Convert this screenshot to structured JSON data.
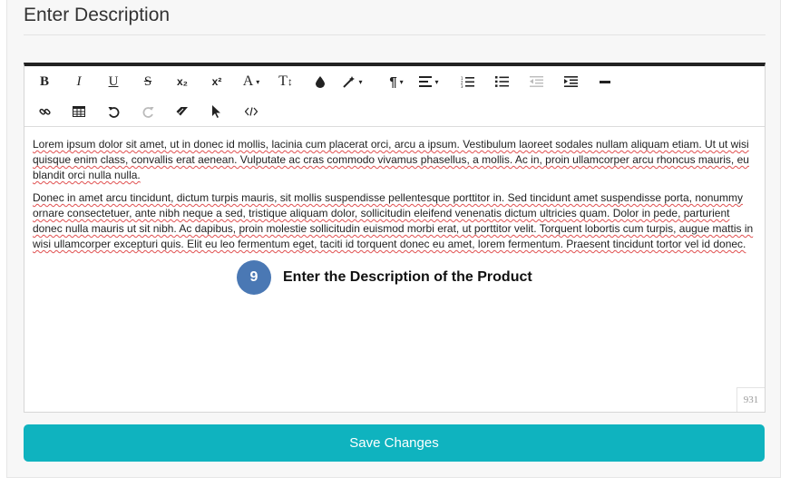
{
  "header": {
    "title": "Enter Description"
  },
  "editor": {
    "paragraphs": [
      "Lorem ipsum dolor sit amet, ut in donec id mollis, lacinia cum placerat orci, arcu a ipsum. Vestibulum laoreet sodales nullam aliquam etiam. Ut ut wisi quisque enim class, convallis erat aenean. Vulputate ac cras commodo vivamus phasellus, a mollis. Ac in, proin ullamcorper arcu rhoncus mauris, eu blandit orci nulla nulla.",
      "Donec in amet arcu tincidunt, dictum turpis mauris, sit mollis suspendisse pellentesque porttitor in. Sed tincidunt amet suspendisse porta, nonummy ornare consectetuer, ante nibh neque a sed, tristique aliquam dolor, sollicitudin eleifend venenatis dictum ultricies quam. Dolor in pede, parturient donec nulla mauris ut sit nibh. Ac dapibus, proin molestie sollicitudin euismod morbi erat, ut porttitor velit. Torquent lobortis cum turpis, augue mattis in wisi ullamcorper excepturi quis. Elit eu leo fermentum eget, taciti id torquent donec eu amet, lorem fermentum. Praesent tincidunt tortor vel id donec."
    ],
    "char_count": "931",
    "toolbar": {
      "bold": "B",
      "italic": "I",
      "underline": "U",
      "strikethrough": "S",
      "subscript": "x₂",
      "superscript": "x²",
      "font_color": "A",
      "text_size": "T",
      "paragraph": "¶",
      "caret": "▾"
    }
  },
  "callout": {
    "number": "9",
    "text": "Enter the Description of the Product"
  },
  "actions": {
    "save_label": "Save Changes"
  },
  "colors": {
    "accent": "#0fb3bf",
    "badge": "#4a78b4",
    "toolbar_border": "#222222"
  }
}
